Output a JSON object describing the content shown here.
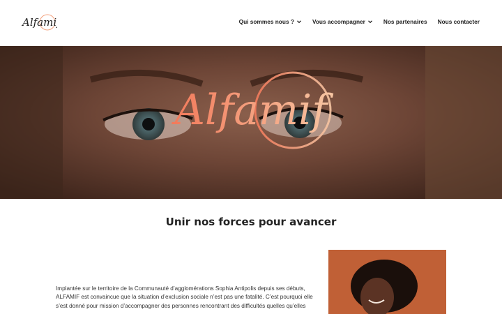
{
  "header": {
    "logo_text": "Alfamif",
    "nav": [
      {
        "label": "Qui sommes nous ?",
        "has_dropdown": true
      },
      {
        "label": "Vous accompagner",
        "has_dropdown": true
      },
      {
        "label": "Nos partenaires",
        "has_dropdown": false
      },
      {
        "label": "Nous contacter",
        "has_dropdown": false
      }
    ]
  },
  "hero": {
    "brand_script": "Alfamif"
  },
  "main": {
    "section_title": "Unir nos forces pour avancer",
    "intro_lines": [
      "Implantée sur le territoire de la Communauté d’agglomérations Sophia Antipolis depuis ses débuts,",
      "ALFAMIF est convaincue que la situation d’exclusion sociale n’est pas une fatalité. C’est pourquoi elle",
      "s’est donné pour mission d’accompagner des personnes rencontrant des difficultés quelles qu’elles"
    ]
  },
  "colors": {
    "accent_orange": "#f08a5d",
    "accent_peach": "#f7c6a3",
    "text_dark": "#222222",
    "photo_bg": "#c8663a"
  }
}
